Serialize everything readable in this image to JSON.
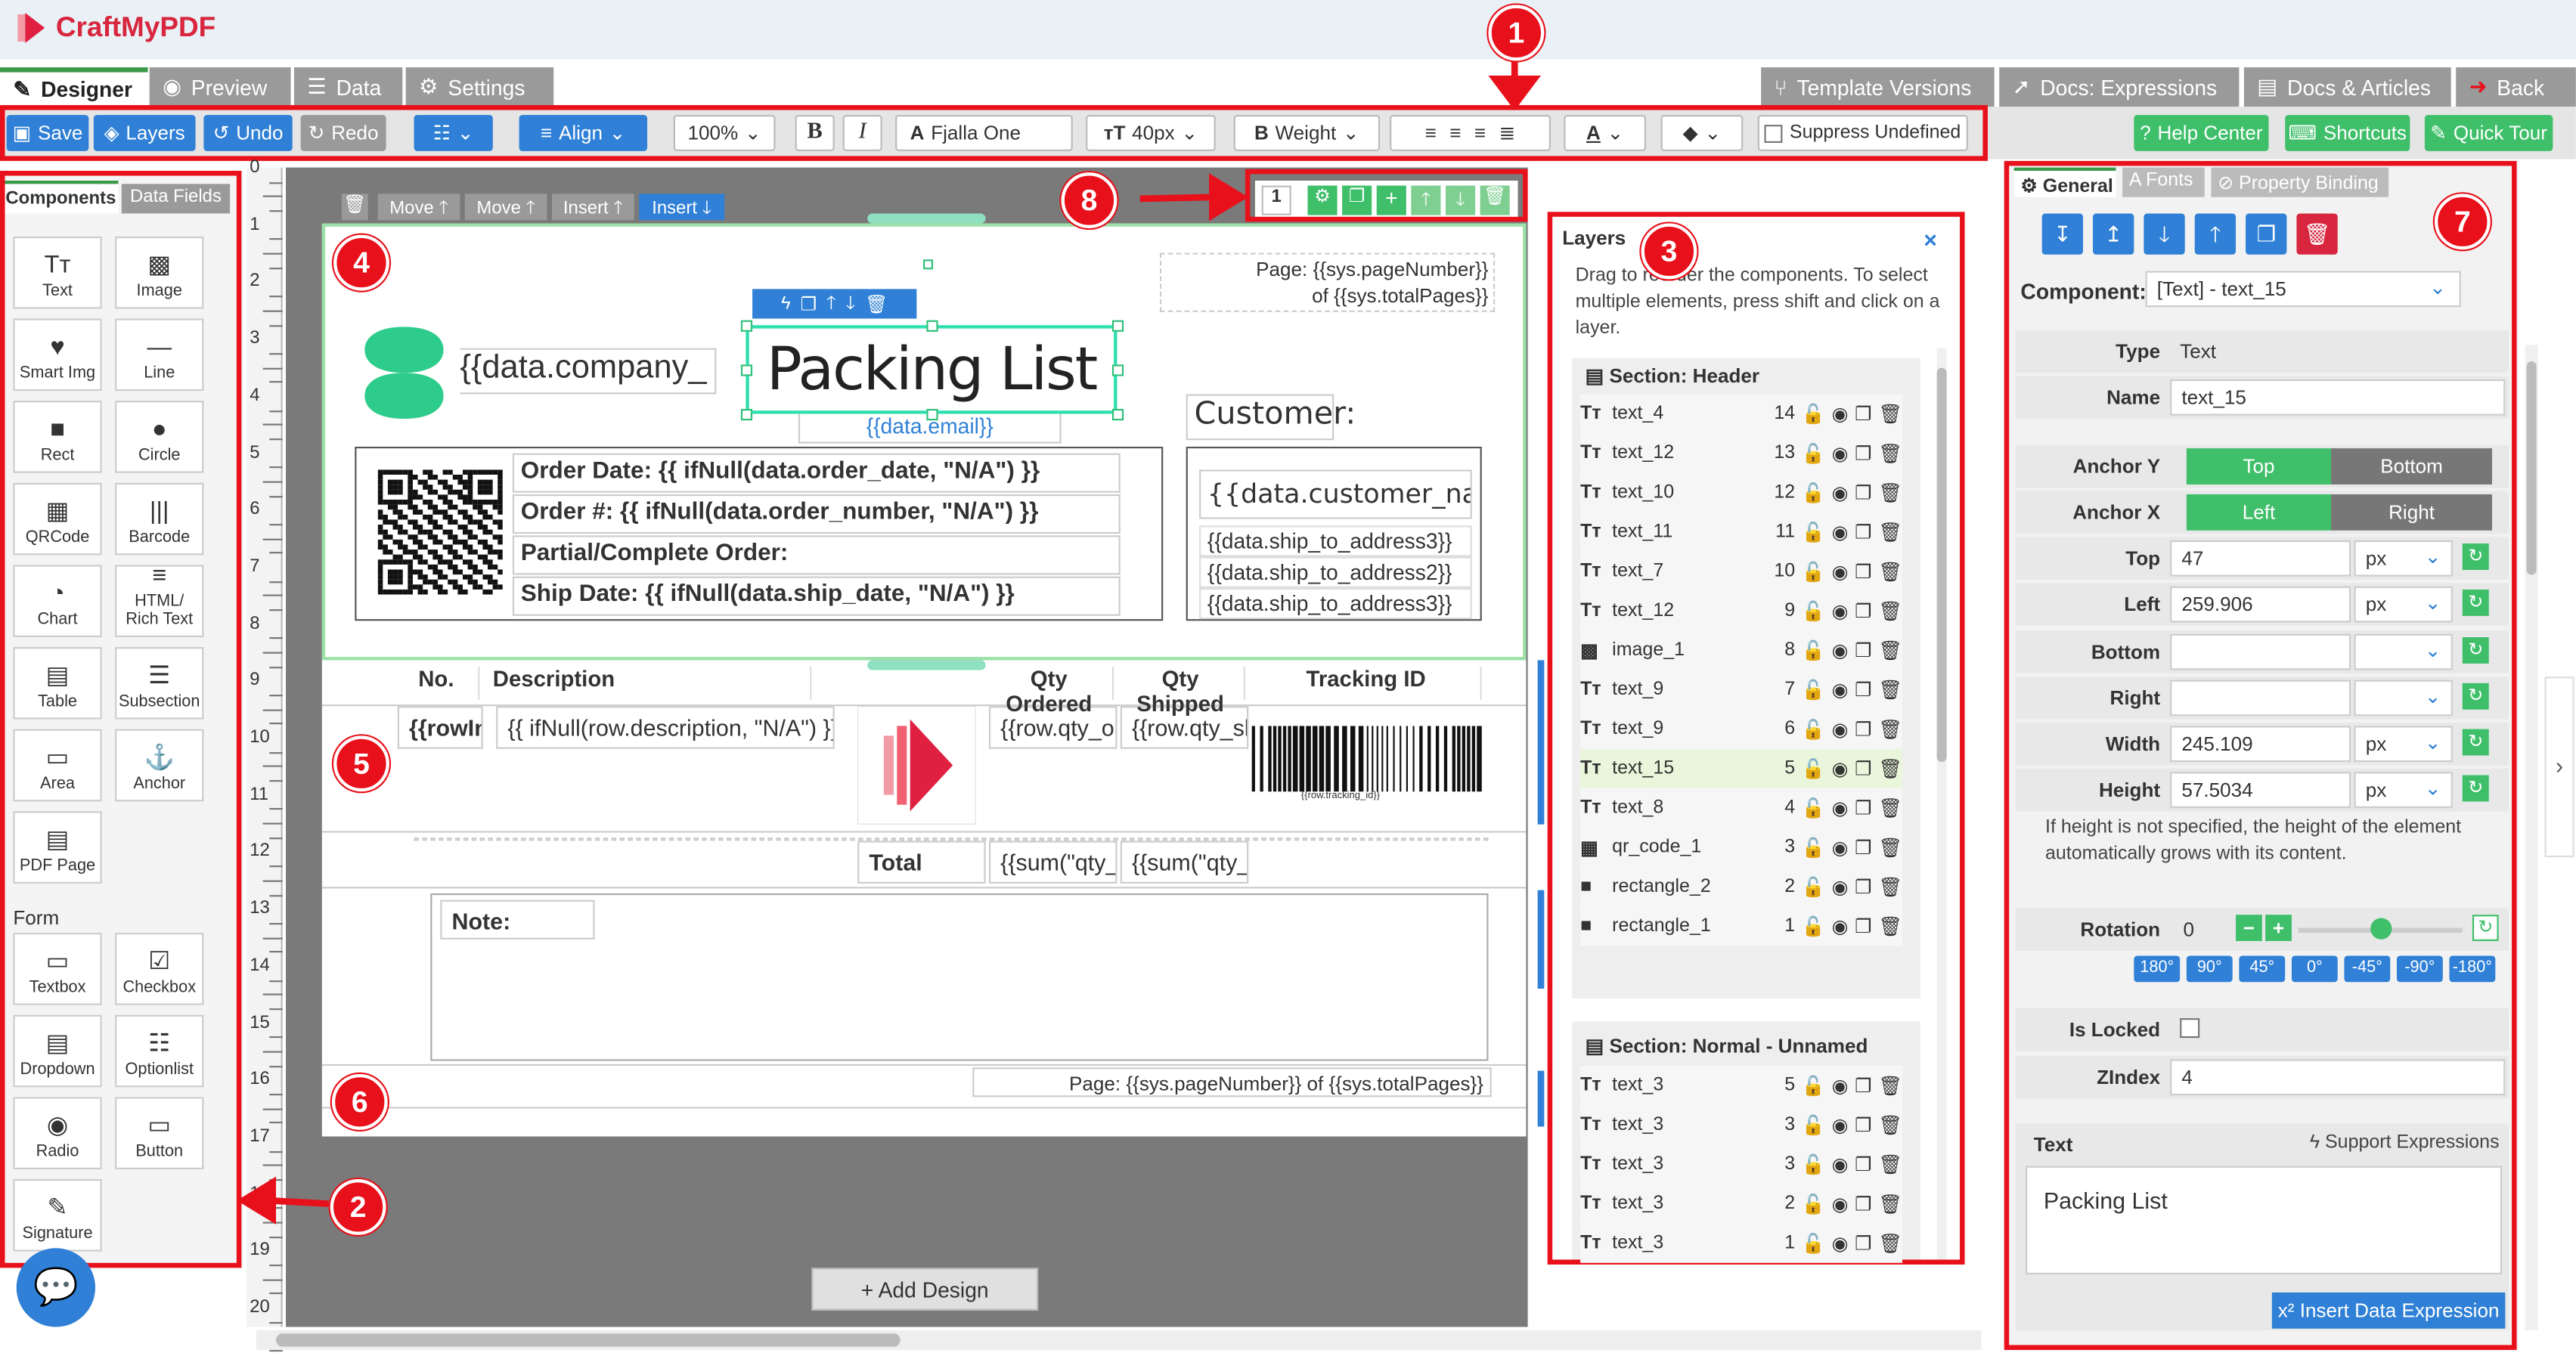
{
  "app": {
    "name": "CraftMyPDF"
  },
  "tabs": [
    {
      "label": "Designer"
    },
    {
      "label": "Preview"
    },
    {
      "label": "Data"
    },
    {
      "label": "Settings"
    }
  ],
  "right_tabs": [
    {
      "label": "Template Versions"
    },
    {
      "label": "Docs: Expressions"
    },
    {
      "label": "Docs & Articles"
    },
    {
      "label": "Back"
    }
  ],
  "toolbar": {
    "save": "Save",
    "layers": "Layers",
    "undo": "Undo",
    "redo": "Redo",
    "align": "Align",
    "zoom": "100%",
    "bold": "B",
    "italic": "I",
    "font": "Fjalla One",
    "size": "40px",
    "weight": "Weight",
    "suppress": "Suppress Undefined",
    "help": "Help Center",
    "shortcuts": "Shortcuts",
    "tour": "Quick Tour"
  },
  "left": {
    "tab_components": "Components",
    "tab_fields": "Data Fields",
    "form_heading": "Form",
    "components": [
      {
        "label": "Text",
        "icon": "Tт"
      },
      {
        "label": "Image",
        "icon": "▩"
      },
      {
        "label": "Smart Img",
        "icon": "♥"
      },
      {
        "label": "Line",
        "icon": "—"
      },
      {
        "label": "Rect",
        "icon": "■"
      },
      {
        "label": "Circle",
        "icon": "●"
      },
      {
        "label": "QRCode",
        "icon": "▦"
      },
      {
        "label": "Barcode",
        "icon": "|||"
      },
      {
        "label": "Chart",
        "icon": "◔"
      },
      {
        "label": "HTML/ Rich Text",
        "icon": "≡"
      },
      {
        "label": "Table",
        "icon": "▤"
      },
      {
        "label": "Subsection",
        "icon": "☰"
      },
      {
        "label": "Area",
        "icon": "▭"
      },
      {
        "label": "Anchor",
        "icon": "⚓"
      },
      {
        "label": "PDF Page",
        "icon": "▤"
      }
    ],
    "form": [
      {
        "label": "Textbox",
        "icon": "▭"
      },
      {
        "label": "Checkbox",
        "icon": "☑"
      },
      {
        "label": "Dropdown",
        "icon": "▤"
      },
      {
        "label": "Optionlist",
        "icon": "☷"
      },
      {
        "label": "Radio",
        "icon": "◉"
      },
      {
        "label": "Button",
        "icon": "▭"
      },
      {
        "label": "Signature",
        "icon": "✎"
      }
    ]
  },
  "ruler": [
    "0",
    "1",
    "2",
    "3",
    "4",
    "5",
    "6",
    "7",
    "8",
    "9",
    "10",
    "11",
    "12",
    "13",
    "14",
    "15",
    "16",
    "17",
    "18",
    "19",
    "20"
  ],
  "canvas": {
    "trash": "🗑",
    "move_up": "Move",
    "move_down": "Move",
    "insert_up": "Insert",
    "insert_down": "Insert",
    "add_design": "+ Add Design",
    "page_num": "1"
  },
  "doc": {
    "page_header": "Page: {{sys.pageNumber}} of {{sys.totalPages}}",
    "company": "{{data.company_",
    "title": "Packing List",
    "email": "{{data.email}}",
    "customer": "Customer:",
    "order_lines": [
      "Order Date: {{ ifNull(data.order_date, \"N/A\") }}",
      "Order #: {{ ifNull(data.order_number, \"N/A\") }}",
      "Partial/Complete Order:",
      "Ship Date: {{ ifNull(data.ship_date, \"N/A\") }}"
    ],
    "customer_name": "{{data.customer_name}}",
    "ship_lines": [
      "{{data.ship_to_address3}}",
      "{{data.ship_to_address2}}",
      "{{data.ship_to_address3}}"
    ],
    "cols": [
      "No.",
      "Description",
      "Qty Ordered",
      "Qty Shipped",
      "Tracking ID"
    ],
    "row": [
      "{{rowInd",
      "{{ ifNull(row.description, \"N/A\") }}",
      "{{row.qty_orc",
      "{{row.qty_sh"
    ],
    "barcode_text": "{{row.tracking_id}}",
    "total": "Total",
    "sum1": "{{sum(\"qty_c",
    "sum2": "{{sum(\"qty_s",
    "note": "Note:",
    "footer": "Page: {{sys.pageNumber}} of {{sys.totalPages}}"
  },
  "layers": {
    "title": "Layers",
    "hint": "Drag to reorder the components. To select multiple elements, press shift and click on a layer.",
    "close": "×",
    "section1": "Section: Header",
    "items1": [
      {
        "name": "text_4",
        "z": "14"
      },
      {
        "name": "text_12",
        "z": "13"
      },
      {
        "name": "text_10",
        "z": "12"
      },
      {
        "name": "text_11",
        "z": "11"
      },
      {
        "name": "text_7",
        "z": "10"
      },
      {
        "name": "text_12",
        "z": "9"
      },
      {
        "name": "image_1",
        "z": "8"
      },
      {
        "name": "text_9",
        "z": "7"
      },
      {
        "name": "text_9",
        "z": "6"
      },
      {
        "name": "text_15",
        "z": "5"
      },
      {
        "name": "text_8",
        "z": "4"
      },
      {
        "name": "qr_code_1",
        "z": "3"
      },
      {
        "name": "rectangle_2",
        "z": "2"
      },
      {
        "name": "rectangle_1",
        "z": "1"
      }
    ],
    "section2": "Section: Normal - Unnamed",
    "items2": [
      {
        "name": "text_3",
        "z": "5"
      },
      {
        "name": "text_3",
        "z": "3"
      },
      {
        "name": "text_3",
        "z": "3"
      },
      {
        "name": "text_3",
        "z": "2"
      },
      {
        "name": "text_3",
        "z": "1"
      }
    ]
  },
  "props": {
    "tab_general": "General",
    "tab_fonts": "Fonts",
    "tab_binding": "Property Binding",
    "component_label": "Component:",
    "component": "[Text] - text_15",
    "type_label": "Type",
    "type": "Text",
    "name_label": "Name",
    "name": "text_15",
    "anchor_y": "Anchor Y",
    "top_opt": "Top",
    "bottom_opt": "Bottom",
    "anchor_x": "Anchor X",
    "left_opt": "Left",
    "right_opt": "Right",
    "top_label": "Top",
    "top": "47",
    "left_label": "Left",
    "left": "259.906",
    "bottom_label": "Bottom",
    "right_label": "Right",
    "width_label": "Width",
    "width": "245.109",
    "height_label": "Height",
    "height": "57.5034",
    "unit": "px",
    "height_hint": "If height is not specified, the height of the element automatically grows with its content.",
    "rotation_label": "Rotation",
    "rotation": "0",
    "angles": [
      "180°",
      "90°",
      "45°",
      "0°",
      "-45°",
      "-90°",
      "-180°"
    ],
    "locked_label": "Is Locked",
    "zindex_label": "ZIndex",
    "zindex": "4",
    "text_label": "Text",
    "support": "Support Expressions",
    "text_value": "Packing List",
    "insert_expr": "Insert Data Expression"
  },
  "badges": [
    "1",
    "2",
    "3",
    "4",
    "5",
    "6",
    "7",
    "8"
  ]
}
